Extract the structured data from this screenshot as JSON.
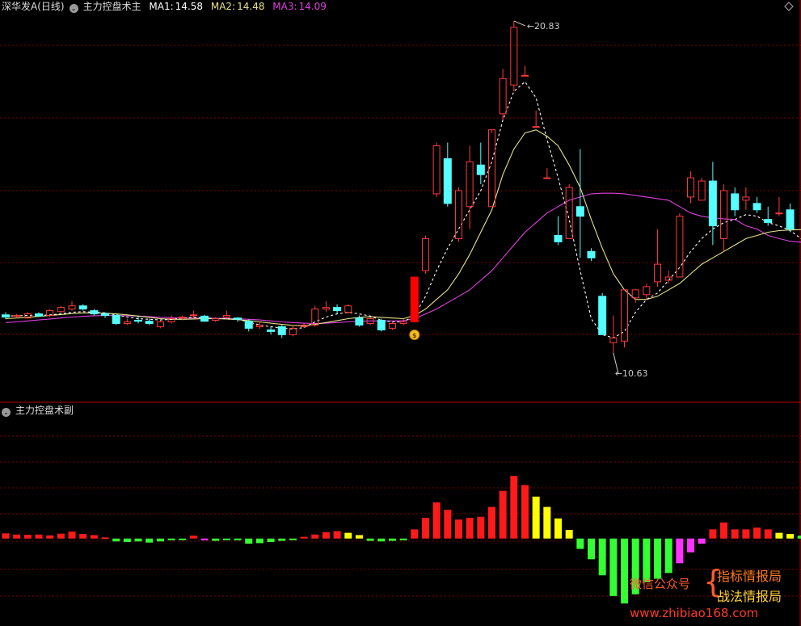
{
  "header": {
    "stock": "深华发A(日线)",
    "indicator": "主力控盘术主",
    "ma1_label": "MA1:",
    "ma1_value": "14.58",
    "ma2_label": "MA2:",
    "ma2_value": "14.48",
    "ma3_label": "MA3:",
    "ma3_value": "14.09"
  },
  "sub_header": {
    "indicator": "主力控盘术副"
  },
  "annotations": {
    "high": "20.83",
    "low": "10.63"
  },
  "watermark": {
    "wechat": "微信公众号",
    "line1": "指标情报局",
    "line2": "战法情报局",
    "url": "www.zhibiao168.com"
  },
  "colors": {
    "up": "#ff3a3a",
    "down": "#54ffff",
    "ma1": "#ffffff",
    "ma2": "#e8e288",
    "ma3": "#e040e0",
    "hist_red": "#ff1a1a",
    "hist_yellow": "#ffff00",
    "hist_green": "#33ff33",
    "hist_magenta": "#ff33ff",
    "grid": "#800000"
  },
  "chart_data": [
    {
      "type": "candlestick",
      "title": "深华发A(日线)",
      "price_range": [
        10.3,
        21.2
      ],
      "candles": [
        {
          "o": 11.82,
          "h": 11.9,
          "l": 11.68,
          "c": 11.75
        },
        {
          "o": 11.78,
          "h": 11.85,
          "l": 11.72,
          "c": 11.8
        },
        {
          "o": 11.72,
          "h": 11.9,
          "l": 11.7,
          "c": 11.85
        },
        {
          "o": 11.85,
          "h": 11.9,
          "l": 11.75,
          "c": 11.78
        },
        {
          "o": 11.8,
          "h": 12.0,
          "l": 11.75,
          "c": 11.95
        },
        {
          "o": 11.92,
          "h": 12.1,
          "l": 11.88,
          "c": 12.05
        },
        {
          "o": 12.0,
          "h": 12.25,
          "l": 11.95,
          "c": 12.1
        },
        {
          "o": 12.1,
          "h": 12.15,
          "l": 11.95,
          "c": 12.0
        },
        {
          "o": 11.95,
          "h": 12.0,
          "l": 11.8,
          "c": 11.85
        },
        {
          "o": 11.85,
          "h": 11.9,
          "l": 11.72,
          "c": 11.8
        },
        {
          "o": 11.8,
          "h": 11.85,
          "l": 11.5,
          "c": 11.55
        },
        {
          "o": 11.55,
          "h": 11.7,
          "l": 11.5,
          "c": 11.6
        },
        {
          "o": 11.65,
          "h": 11.8,
          "l": 11.55,
          "c": 11.62
        },
        {
          "o": 11.62,
          "h": 11.7,
          "l": 11.5,
          "c": 11.55
        },
        {
          "o": 11.45,
          "h": 11.65,
          "l": 11.4,
          "c": 11.6
        },
        {
          "o": 11.6,
          "h": 11.8,
          "l": 11.55,
          "c": 11.7
        },
        {
          "o": 11.72,
          "h": 11.8,
          "l": 11.65,
          "c": 11.75
        },
        {
          "o": 11.8,
          "h": 11.95,
          "l": 11.7,
          "c": 11.82
        },
        {
          "o": 11.78,
          "h": 11.82,
          "l": 11.6,
          "c": 11.62
        },
        {
          "o": 11.65,
          "h": 11.75,
          "l": 11.6,
          "c": 11.7
        },
        {
          "o": 11.75,
          "h": 11.95,
          "l": 11.7,
          "c": 11.8
        },
        {
          "o": 11.72,
          "h": 11.75,
          "l": 11.6,
          "c": 11.68
        },
        {
          "o": 11.62,
          "h": 11.68,
          "l": 11.3,
          "c": 11.4
        },
        {
          "o": 11.45,
          "h": 11.6,
          "l": 11.38,
          "c": 11.5
        },
        {
          "o": 11.35,
          "h": 11.45,
          "l": 11.2,
          "c": 11.3
        },
        {
          "o": 11.45,
          "h": 11.5,
          "l": 11.1,
          "c": 11.2
        },
        {
          "o": 11.2,
          "h": 11.5,
          "l": 11.15,
          "c": 11.4
        },
        {
          "o": 11.45,
          "h": 11.55,
          "l": 11.42,
          "c": 11.5
        },
        {
          "o": 11.5,
          "h": 12.1,
          "l": 11.45,
          "c": 12.0
        },
        {
          "o": 12.0,
          "h": 12.25,
          "l": 11.9,
          "c": 12.05
        },
        {
          "o": 12.05,
          "h": 12.15,
          "l": 11.85,
          "c": 11.95
        },
        {
          "o": 11.9,
          "h": 12.15,
          "l": 11.85,
          "c": 12.1
        },
        {
          "o": 11.72,
          "h": 11.8,
          "l": 11.45,
          "c": 11.5
        },
        {
          "o": 11.55,
          "h": 11.75,
          "l": 11.5,
          "c": 11.7
        },
        {
          "o": 11.65,
          "h": 11.7,
          "l": 11.3,
          "c": 11.35
        },
        {
          "o": 11.4,
          "h": 11.6,
          "l": 11.35,
          "c": 11.55
        },
        {
          "o": 11.55,
          "h": 11.7,
          "l": 11.5,
          "c": 11.6
        },
        {
          "o": 11.6,
          "h": 13.0,
          "l": 11.6,
          "c": 13.0
        },
        {
          "o": 13.2,
          "h": 14.3,
          "l": 13.1,
          "c": 14.2
        },
        {
          "o": 15.6,
          "h": 17.2,
          "l": 15.5,
          "c": 17.1
        },
        {
          "o": 16.7,
          "h": 17.2,
          "l": 15.2,
          "c": 15.3
        },
        {
          "o": 14.2,
          "h": 15.8,
          "l": 14.1,
          "c": 15.7
        },
        {
          "o": 15.2,
          "h": 17.1,
          "l": 14.5,
          "c": 16.6
        },
        {
          "o": 16.5,
          "h": 17.2,
          "l": 15.9,
          "c": 16.2
        },
        {
          "o": 15.2,
          "h": 17.5,
          "l": 15.2,
          "c": 17.6
        },
        {
          "o": 18.1,
          "h": 19.5,
          "l": 17.9,
          "c": 19.2
        },
        {
          "o": 19.0,
          "h": 21.0,
          "l": 18.8,
          "c": 20.8
        },
        {
          "o": 19.3,
          "h": 19.6,
          "l": 19.3,
          "c": 19.3
        },
        {
          "o": 17.7,
          "h": 18.2,
          "l": 17.7,
          "c": 17.7
        },
        {
          "o": 16.1,
          "h": 16.4,
          "l": 16.1,
          "c": 16.1
        },
        {
          "o": 14.3,
          "h": 14.9,
          "l": 14.0,
          "c": 14.1
        },
        {
          "o": 14.2,
          "h": 15.9,
          "l": 14.2,
          "c": 15.8
        },
        {
          "o": 15.2,
          "h": 17.0,
          "l": 13.6,
          "c": 14.9
        },
        {
          "o": 13.8,
          "h": 13.9,
          "l": 13.5,
          "c": 13.6
        },
        {
          "o": 12.4,
          "h": 12.5,
          "l": 11.2,
          "c": 11.2
        },
        {
          "o": 10.95,
          "h": 11.8,
          "l": 10.63,
          "c": 11.1
        },
        {
          "o": 11.0,
          "h": 12.6,
          "l": 10.8,
          "c": 12.6
        },
        {
          "o": 12.35,
          "h": 12.6,
          "l": 12.2,
          "c": 12.6
        },
        {
          "o": 12.45,
          "h": 12.8,
          "l": 12.3,
          "c": 12.7
        },
        {
          "o": 12.85,
          "h": 14.5,
          "l": 12.7,
          "c": 13.4
        },
        {
          "o": 12.9,
          "h": 13.2,
          "l": 12.8,
          "c": 13.0
        },
        {
          "o": 13.0,
          "h": 15.0,
          "l": 13.0,
          "c": 14.9
        },
        {
          "o": 15.5,
          "h": 16.3,
          "l": 15.3,
          "c": 16.1
        },
        {
          "o": 15.4,
          "h": 16.1,
          "l": 15.4,
          "c": 16.0
        },
        {
          "o": 16.0,
          "h": 16.6,
          "l": 14.0,
          "c": 14.6
        },
        {
          "o": 14.2,
          "h": 15.9,
          "l": 13.8,
          "c": 15.7
        },
        {
          "o": 15.6,
          "h": 15.8,
          "l": 14.9,
          "c": 15.1
        },
        {
          "o": 15.4,
          "h": 15.8,
          "l": 15.1,
          "c": 15.5
        },
        {
          "o": 15.3,
          "h": 15.5,
          "l": 15.0,
          "c": 15.1
        },
        {
          "o": 14.8,
          "h": 15.2,
          "l": 14.6,
          "c": 14.7
        },
        {
          "o": 15.0,
          "h": 15.5,
          "l": 14.9,
          "c": 15.0
        },
        {
          "o": 15.1,
          "h": 15.3,
          "l": 14.4,
          "c": 14.5
        }
      ],
      "ma1": [
        11.78,
        11.79,
        11.8,
        11.8,
        11.82,
        11.85,
        11.9,
        11.92,
        11.9,
        11.88,
        11.82,
        11.75,
        11.7,
        11.68,
        11.66,
        11.68,
        11.72,
        11.74,
        11.72,
        11.7,
        11.7,
        11.68,
        11.6,
        11.5,
        11.45,
        11.4,
        11.38,
        11.42,
        11.6,
        11.75,
        11.85,
        11.9,
        11.85,
        11.78,
        11.65,
        11.6,
        11.6,
        11.8,
        12.4,
        13.2,
        13.9,
        14.5,
        15.1,
        15.7,
        16.6,
        17.9,
        18.8,
        19.1,
        18.6,
        17.3,
        16.1,
        14.8,
        13.2,
        11.7,
        11.2,
        11.1,
        11.3,
        11.9,
        12.3,
        12.5,
        12.9,
        13.3,
        13.8,
        14.2,
        14.5,
        14.7,
        14.8,
        14.95,
        14.9,
        14.7,
        14.6,
        14.45,
        14.2
      ],
      "ma2": [
        11.7,
        11.72,
        11.74,
        11.77,
        11.8,
        11.83,
        11.86,
        11.88,
        11.88,
        11.87,
        11.85,
        11.82,
        11.78,
        11.74,
        11.7,
        11.68,
        11.68,
        11.69,
        11.7,
        11.7,
        11.69,
        11.67,
        11.64,
        11.6,
        11.56,
        11.52,
        11.49,
        11.48,
        11.52,
        11.58,
        11.64,
        11.7,
        11.74,
        11.76,
        11.74,
        11.72,
        11.7,
        11.8,
        12.0,
        12.3,
        12.6,
        13.1,
        13.7,
        14.4,
        15.1,
        16.2,
        17.0,
        17.5,
        17.6,
        17.4,
        17.1,
        16.5,
        15.8,
        14.8,
        13.9,
        13.1,
        12.6,
        12.3,
        12.3,
        12.4,
        12.6,
        12.8,
        13.1,
        13.4,
        13.6,
        13.8,
        14.0,
        14.2,
        14.3,
        14.4,
        14.45,
        14.47,
        14.48
      ],
      "ma3": [
        11.58,
        11.6,
        11.63,
        11.66,
        11.69,
        11.72,
        11.75,
        11.77,
        11.79,
        11.8,
        11.8,
        11.79,
        11.78,
        11.76,
        11.74,
        11.73,
        11.72,
        11.72,
        11.72,
        11.71,
        11.71,
        11.7,
        11.68,
        11.66,
        11.63,
        11.6,
        11.58,
        11.56,
        11.55,
        11.56,
        11.58,
        11.6,
        11.62,
        11.63,
        11.63,
        11.63,
        11.64,
        11.7,
        11.85,
        12.0,
        12.2,
        12.4,
        12.6,
        12.9,
        13.2,
        13.6,
        14.0,
        14.4,
        14.7,
        15.0,
        15.2,
        15.4,
        15.5,
        15.6,
        15.62,
        15.62,
        15.6,
        15.55,
        15.5,
        15.45,
        15.4,
        15.2,
        15.0,
        14.9,
        14.85,
        14.82,
        14.8,
        14.6,
        14.5,
        14.3,
        14.2,
        14.12,
        14.09
      ],
      "high_label": "20.83",
      "low_label": "10.63"
    },
    {
      "type": "bar",
      "title": "主力控盘术副",
      "y_range": [
        -11,
        15
      ],
      "values": [
        0.9,
        0.7,
        0.65,
        0.7,
        0.55,
        0.85,
        1.2,
        0.8,
        0.6,
        0.2,
        -0.5,
        -0.6,
        -0.5,
        -0.7,
        -0.5,
        -0.3,
        -0.2,
        0.5,
        -0.3,
        -0.4,
        -0.2,
        -0.3,
        -0.9,
        -0.8,
        -0.6,
        -0.4,
        -0.2,
        0.3,
        0.7,
        1.1,
        1.3,
        1.0,
        0.6,
        -0.4,
        -0.5,
        -0.4,
        -0.3,
        1.6,
        3.6,
        6.3,
        5.0,
        3.3,
        3.6,
        3.8,
        5.5,
        8.3,
        10.9,
        9.3,
        7.3,
        5.5,
        3.5,
        1.5,
        -1.8,
        -3.6,
        -6.4,
        -10.0,
        -11.3,
        -9.7,
        -7.6,
        -7.0,
        -6.0,
        -4.3,
        -2.4,
        -0.9,
        1.6,
        2.8,
        1.6,
        1.6,
        1.9,
        1.6,
        1.0,
        0.8,
        0.5
      ],
      "colors": [
        "r",
        "r",
        "r",
        "r",
        "r",
        "r",
        "r",
        "r",
        "r",
        "r",
        "g",
        "g",
        "g",
        "g",
        "g",
        "g",
        "g",
        "r",
        "m",
        "g",
        "g",
        "g",
        "g",
        "g",
        "g",
        "g",
        "g",
        "r",
        "r",
        "r",
        "r",
        "y",
        "y",
        "g",
        "g",
        "g",
        "g",
        "r",
        "r",
        "r",
        "r",
        "r",
        "r",
        "r",
        "r",
        "r",
        "r",
        "r",
        "y",
        "y",
        "y",
        "y",
        "g",
        "g",
        "g",
        "g",
        "g",
        "g",
        "g",
        "g",
        "g",
        "m",
        "m",
        "m",
        "r",
        "r",
        "r",
        "r",
        "r",
        "r",
        "y",
        "y",
        "g"
      ]
    }
  ]
}
